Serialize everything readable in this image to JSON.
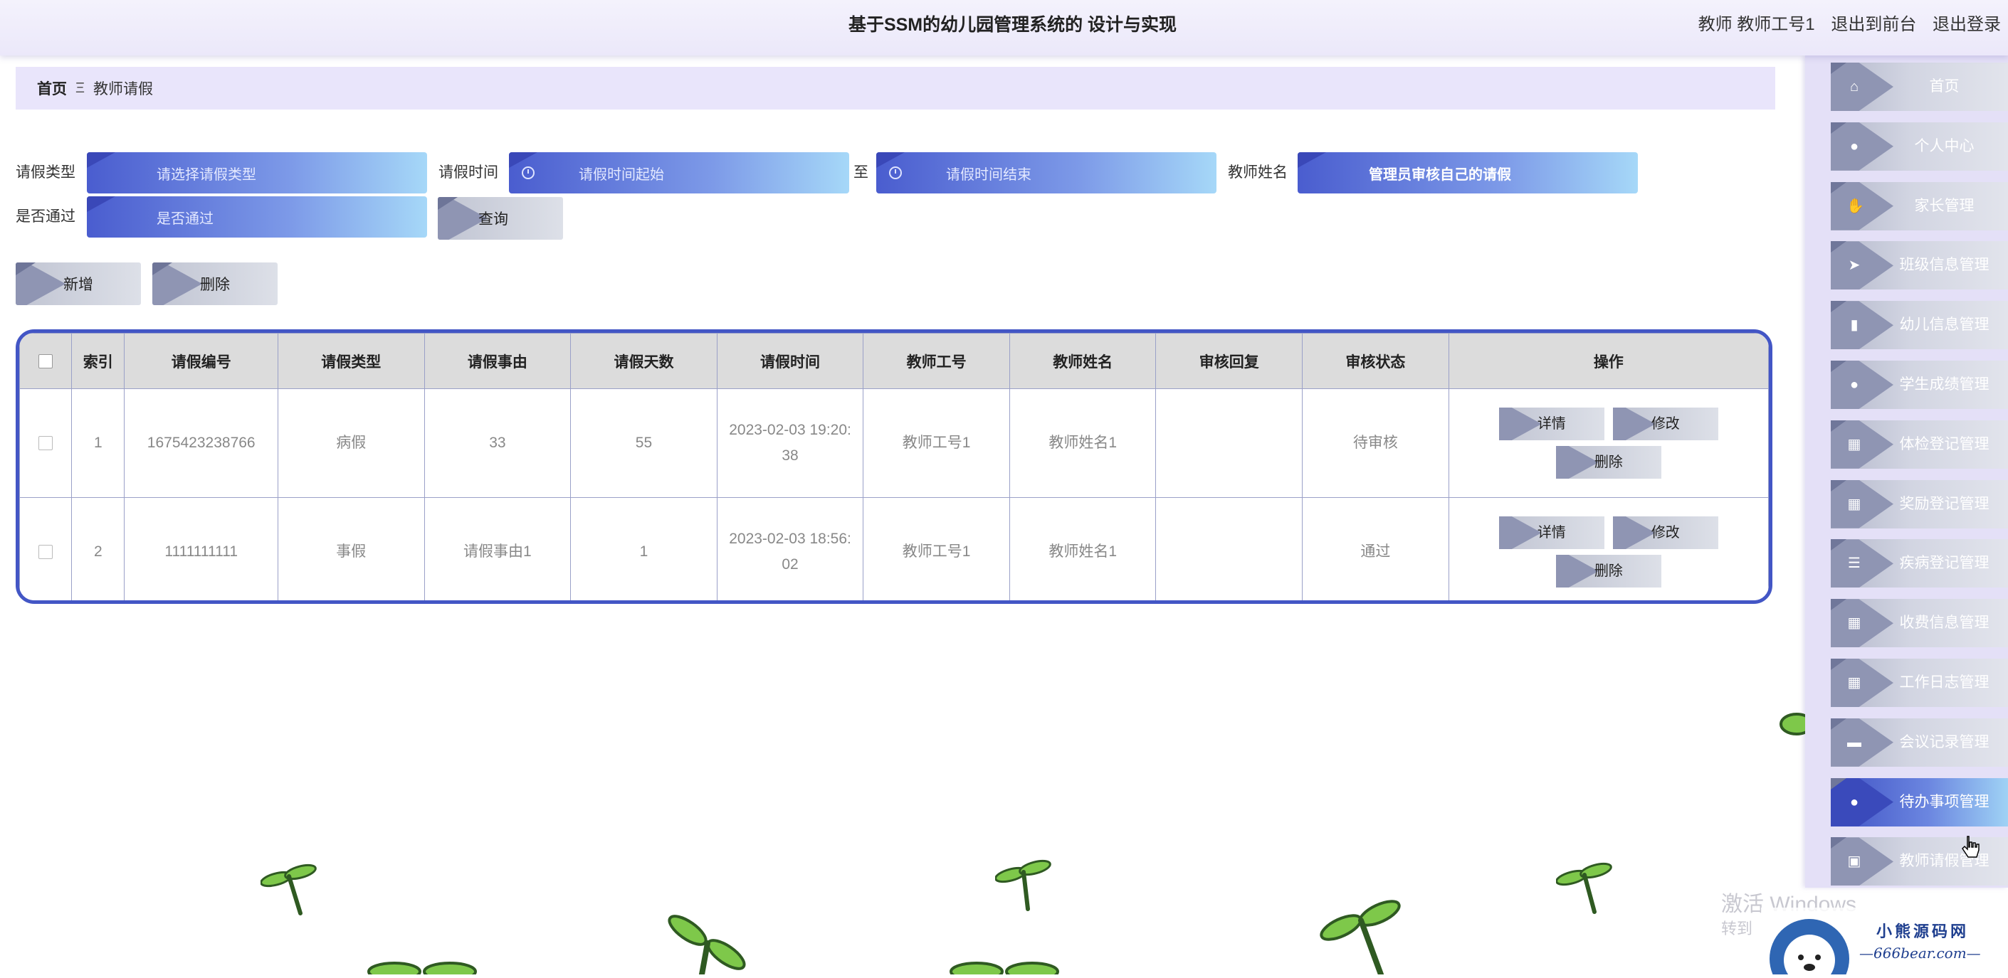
{
  "header": {
    "title": "基于SSM的幼儿园管理系统的 设计与实现",
    "user": "教师 教师工号1",
    "exit_front": "退出到前台",
    "logout": "退出登录"
  },
  "breadcrumb": {
    "home": "首页",
    "separator": "Ξ",
    "current": "教师请假"
  },
  "search": {
    "leave_type_label": "请假类型",
    "leave_type_placeholder": "请选择请假类型",
    "leave_time_label": "请假时间",
    "start_placeholder": "请假时间起始",
    "to_label": "至",
    "end_placeholder": "请假时间结束",
    "teacher_name_label": "教师姓名",
    "teacher_name_value": "管理员审核自己的请假",
    "approved_label": "是否通过",
    "approved_placeholder": "是否通过",
    "query_button": "查询"
  },
  "actions": {
    "add": "新增",
    "delete": "删除"
  },
  "table": {
    "columns": [
      "索引",
      "请假编号",
      "请假类型",
      "请假事由",
      "请假天数",
      "请假时间",
      "教师工号",
      "教师姓名",
      "审核回复",
      "审核状态",
      "操作"
    ],
    "rows": [
      {
        "index": "1",
        "code": "1675423238766",
        "type": "病假",
        "reason": "33",
        "days": "55",
        "time": "2023-02-03 19:20:38",
        "teacher_no": "教师工号1",
        "teacher_name": "教师姓名1",
        "reply": "",
        "status": "待审核"
      },
      {
        "index": "2",
        "code": "1111111111",
        "type": "事假",
        "reason": "请假事由1",
        "days": "1",
        "time": "2023-02-03 18:56:02",
        "teacher_no": "教师工号1",
        "teacher_name": "教师姓名1",
        "reply": "",
        "status": "通过"
      }
    ],
    "row_actions": {
      "detail": "详情",
      "edit": "修改",
      "delete": "删除"
    }
  },
  "sidebar": {
    "items": [
      {
        "label": "首页",
        "icon": "home-icon",
        "glyph": "⌂"
      },
      {
        "label": "个人中心",
        "icon": "user-icon",
        "glyph": "●"
      },
      {
        "label": "家长管理",
        "icon": "thumbs-up-icon",
        "glyph": "✋"
      },
      {
        "label": "班级信息管理",
        "icon": "send-icon",
        "glyph": "➤"
      },
      {
        "label": "幼儿信息管理",
        "icon": "bar-chart-icon",
        "glyph": "▮"
      },
      {
        "label": "学生成绩管理",
        "icon": "lightbulb-icon",
        "glyph": "●"
      },
      {
        "label": "体检登记管理",
        "icon": "grid-icon",
        "glyph": "▦"
      },
      {
        "label": "奖励登记管理",
        "icon": "grid-icon",
        "glyph": "▦"
      },
      {
        "label": "疾病登记管理",
        "icon": "list-icon",
        "glyph": "☰"
      },
      {
        "label": "收费信息管理",
        "icon": "grid-icon",
        "glyph": "▦"
      },
      {
        "label": "工作日志管理",
        "icon": "table-icon",
        "glyph": "▦"
      },
      {
        "label": "会议记录管理",
        "icon": "printer-icon",
        "glyph": "▬"
      },
      {
        "label": "待办事项管理",
        "icon": "user-icon",
        "glyph": "●",
        "active": true
      },
      {
        "label": "教师请假管理",
        "icon": "clipboard-icon",
        "glyph": "▣"
      }
    ]
  },
  "watermark": {
    "line1": "激活 Windows",
    "line2": "转到"
  },
  "logo": {
    "name": "小熊源码网",
    "url": "—666bear.com—"
  }
}
